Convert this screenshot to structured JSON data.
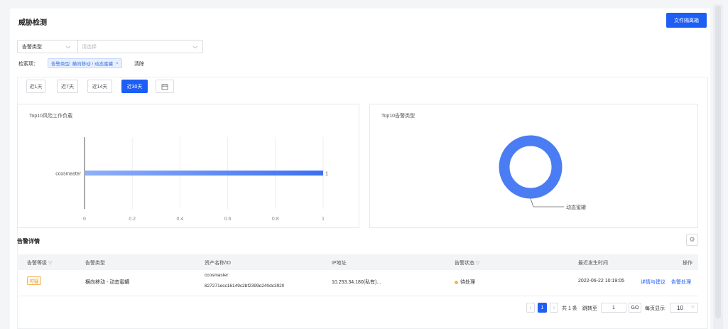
{
  "page": {
    "title": "威胁检测",
    "primary_button": "文件隔离箱"
  },
  "filter": {
    "type_label": "告警类型",
    "value_placeholder": "请选择"
  },
  "search": {
    "label": "检索项：",
    "tag_text": "告警类型: 横向移动 / 动态蜜罐",
    "clear_label": "清除"
  },
  "time_range": {
    "options": [
      "近1天",
      "近7天",
      "近14天",
      "近30天"
    ],
    "selected": "近30天"
  },
  "charts": {
    "left_title": "Top10风险工作负载",
    "right_title": "Top10告警类型",
    "donut_legend": "动态蜜罐"
  },
  "chart_data": [
    {
      "type": "bar",
      "orientation": "horizontal",
      "title": "Top10风险工作负载",
      "categories": [
        "ccosmaster"
      ],
      "values": [
        1
      ],
      "data_labels": [
        "1"
      ],
      "xlim": [
        0,
        1
      ],
      "xticks": [
        "0",
        "0.2",
        "0.4",
        "0.6",
        "0.8",
        "1"
      ],
      "grid": true,
      "colors": [
        "#3b6ff3"
      ]
    },
    {
      "type": "pie",
      "title": "Top10告警类型",
      "categories": [
        "动态蜜罐"
      ],
      "values": [
        1
      ],
      "colors": [
        "#4a7cf3"
      ]
    }
  ],
  "alert_section": {
    "title": "告警详情"
  },
  "table": {
    "headers": [
      "告警等级",
      "告警类型",
      "资产名称/ID",
      "IP地址",
      "告警状态",
      "最近发生时间",
      "操作"
    ],
    "rows": [
      {
        "level": "可疑",
        "type": "横向移动 - 动态蜜罐",
        "asset_name": "ccosmaster",
        "asset_id": "827271ecc16149c2bf2399e240dc3920",
        "ip": "10.253.34.180(私有)...",
        "status": "待处理",
        "time": "2022-06-22 10:19:05",
        "action_detail": "详情与建议",
        "action_handle": "告警处理"
      }
    ]
  },
  "pagination": {
    "current_page": "1",
    "total": "共 1 条",
    "jump_label": "跳转至",
    "jump_value": "1",
    "go_label": "GO",
    "page_size_label": "每页显示",
    "page_size": "10"
  },
  "colors": {
    "accent": "#1d5ef5",
    "warning": "#e69a28"
  }
}
